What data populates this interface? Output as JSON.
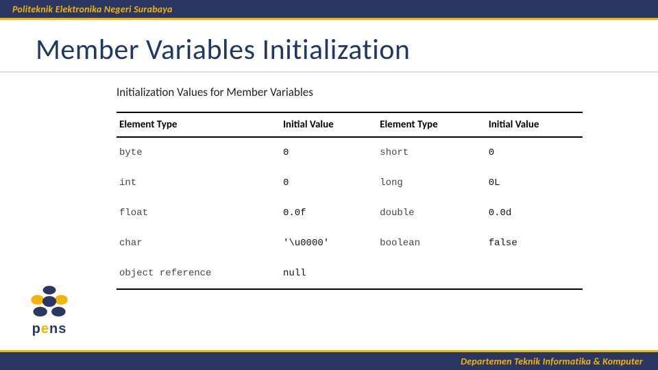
{
  "header": {
    "institution": "Politeknik Elektronika Negeri Surabaya"
  },
  "footer": {
    "department": "Departemen Teknik Informatika & Komputer"
  },
  "logo": {
    "text_p": "p",
    "text_e": "e",
    "text_ns": "ns"
  },
  "title": "Member Variables Initialization",
  "table": {
    "caption": "Initialization Values for Member Variables",
    "headers": {
      "c1": "Element Type",
      "c2": "Initial Value",
      "c3": "Element Type",
      "c4": "Initial Value"
    },
    "rows": [
      {
        "t1": "byte",
        "v1": "0",
        "t2": "short",
        "v2": "0"
      },
      {
        "t1": "int",
        "v1": "0",
        "t2": "long",
        "v2": "0L"
      },
      {
        "t1": "float",
        "v1": "0.0f",
        "t2": "double",
        "v2": "0.0d"
      },
      {
        "t1": "char",
        "v1": "'\\u0000'",
        "t2": "boolean",
        "v2": "false"
      },
      {
        "t1": "object reference",
        "v1": "null",
        "t2": "",
        "v2": ""
      }
    ]
  }
}
